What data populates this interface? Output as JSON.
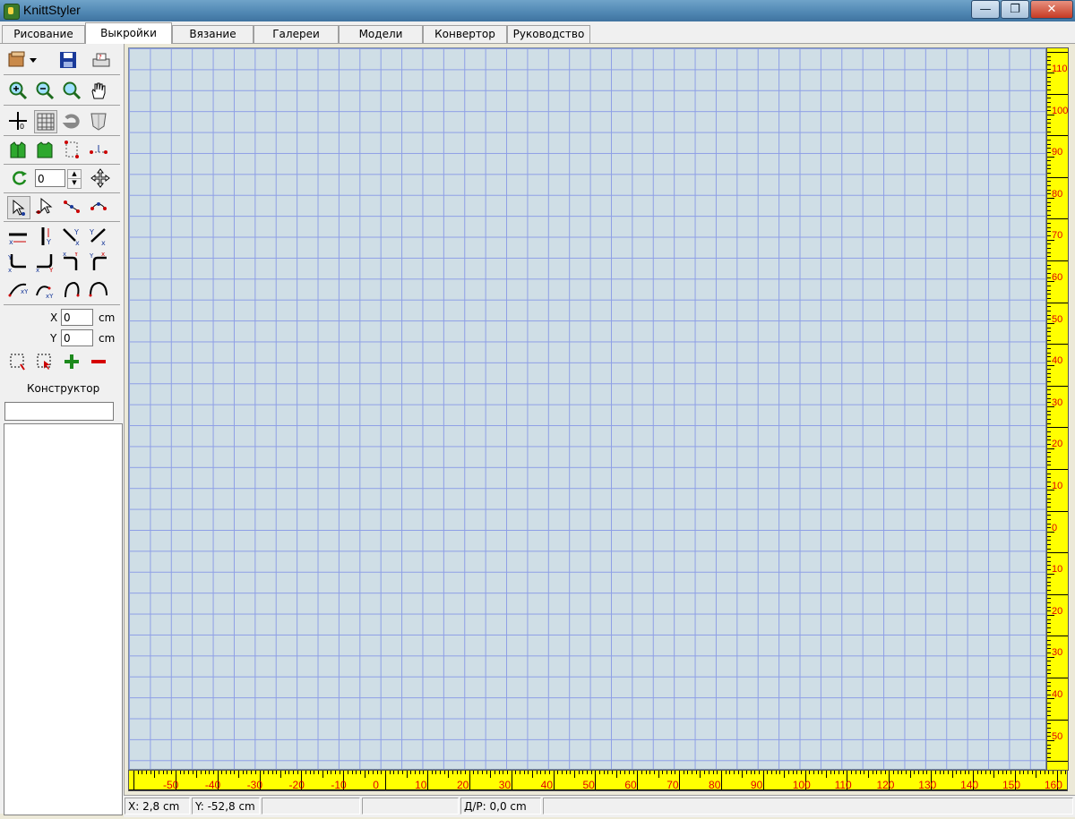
{
  "window": {
    "title": "KnittStyler",
    "minimize_glyph": "—",
    "restore_glyph": "❐",
    "close_glyph": "✕"
  },
  "tabs": [
    {
      "label": "Рисование",
      "active": false
    },
    {
      "label": "Выкройки",
      "active": true
    },
    {
      "label": "Вязание",
      "active": false
    },
    {
      "label": "Галереи",
      "active": false
    },
    {
      "label": "Модели",
      "active": false
    },
    {
      "label": "Конвертор",
      "active": false
    },
    {
      "label": "Руководство",
      "active": false
    }
  ],
  "toolbar": {
    "rotation_value": "0",
    "x_label": "X",
    "x_value": "0",
    "x_unit": "cm",
    "y_label": "Y",
    "y_value": "0",
    "y_unit": "cm",
    "constructor_label": "Конструктор",
    "constructor_field": "",
    "icons": [
      "open-file-icon",
      "save-icon",
      "print-preview-icon",
      "zoom-in-icon",
      "zoom-out-icon",
      "zoom-fit-icon",
      "hand-pan-icon",
      "crosshair-icon",
      "grid-icon",
      "undo-icon",
      "mask-icon",
      "pattern-front-icon",
      "pattern-back-icon",
      "point-select-icon",
      "point-distance-icon",
      "rotate-icon",
      "move-icon",
      "select-arrow-icon",
      "move-point-icon",
      "line-nodes-icon",
      "curve-nodes-icon",
      "horizontal-line-icon",
      "vertical-line-icon",
      "diagonal-down-icon",
      "diagonal-up-icon",
      "corner-1-icon",
      "corner-2-icon",
      "corner-3-icon",
      "corner-4-icon",
      "curve-1-icon",
      "curve-2-icon",
      "curve-3-icon",
      "curve-4-icon",
      "select-rect-icon",
      "select-node-icon",
      "add-icon",
      "remove-icon"
    ]
  },
  "rulers": {
    "color": "#ffff00",
    "label_color": "#e20000",
    "vertical_labels": [
      "110",
      "100",
      "90",
      "80",
      "70",
      "60",
      "50",
      "40",
      "30",
      "20",
      "10",
      "0",
      "10",
      "20",
      "30",
      "40",
      "50"
    ],
    "horizontal_labels": [
      "-50",
      "-40",
      "-30",
      "-20",
      "-10",
      "0",
      "10",
      "20",
      "30",
      "40",
      "50",
      "60",
      "70",
      "80",
      "90",
      "100",
      "110",
      "120",
      "130",
      "140",
      "150",
      "160"
    ]
  },
  "canvas": {
    "background": "#cfdee6",
    "grid_color": "#8e9fe6"
  },
  "status": {
    "x": "X: 2,8 cm",
    "y": "Y: -52,8 cm",
    "dr": "Д/Р: 0,0 cm"
  }
}
